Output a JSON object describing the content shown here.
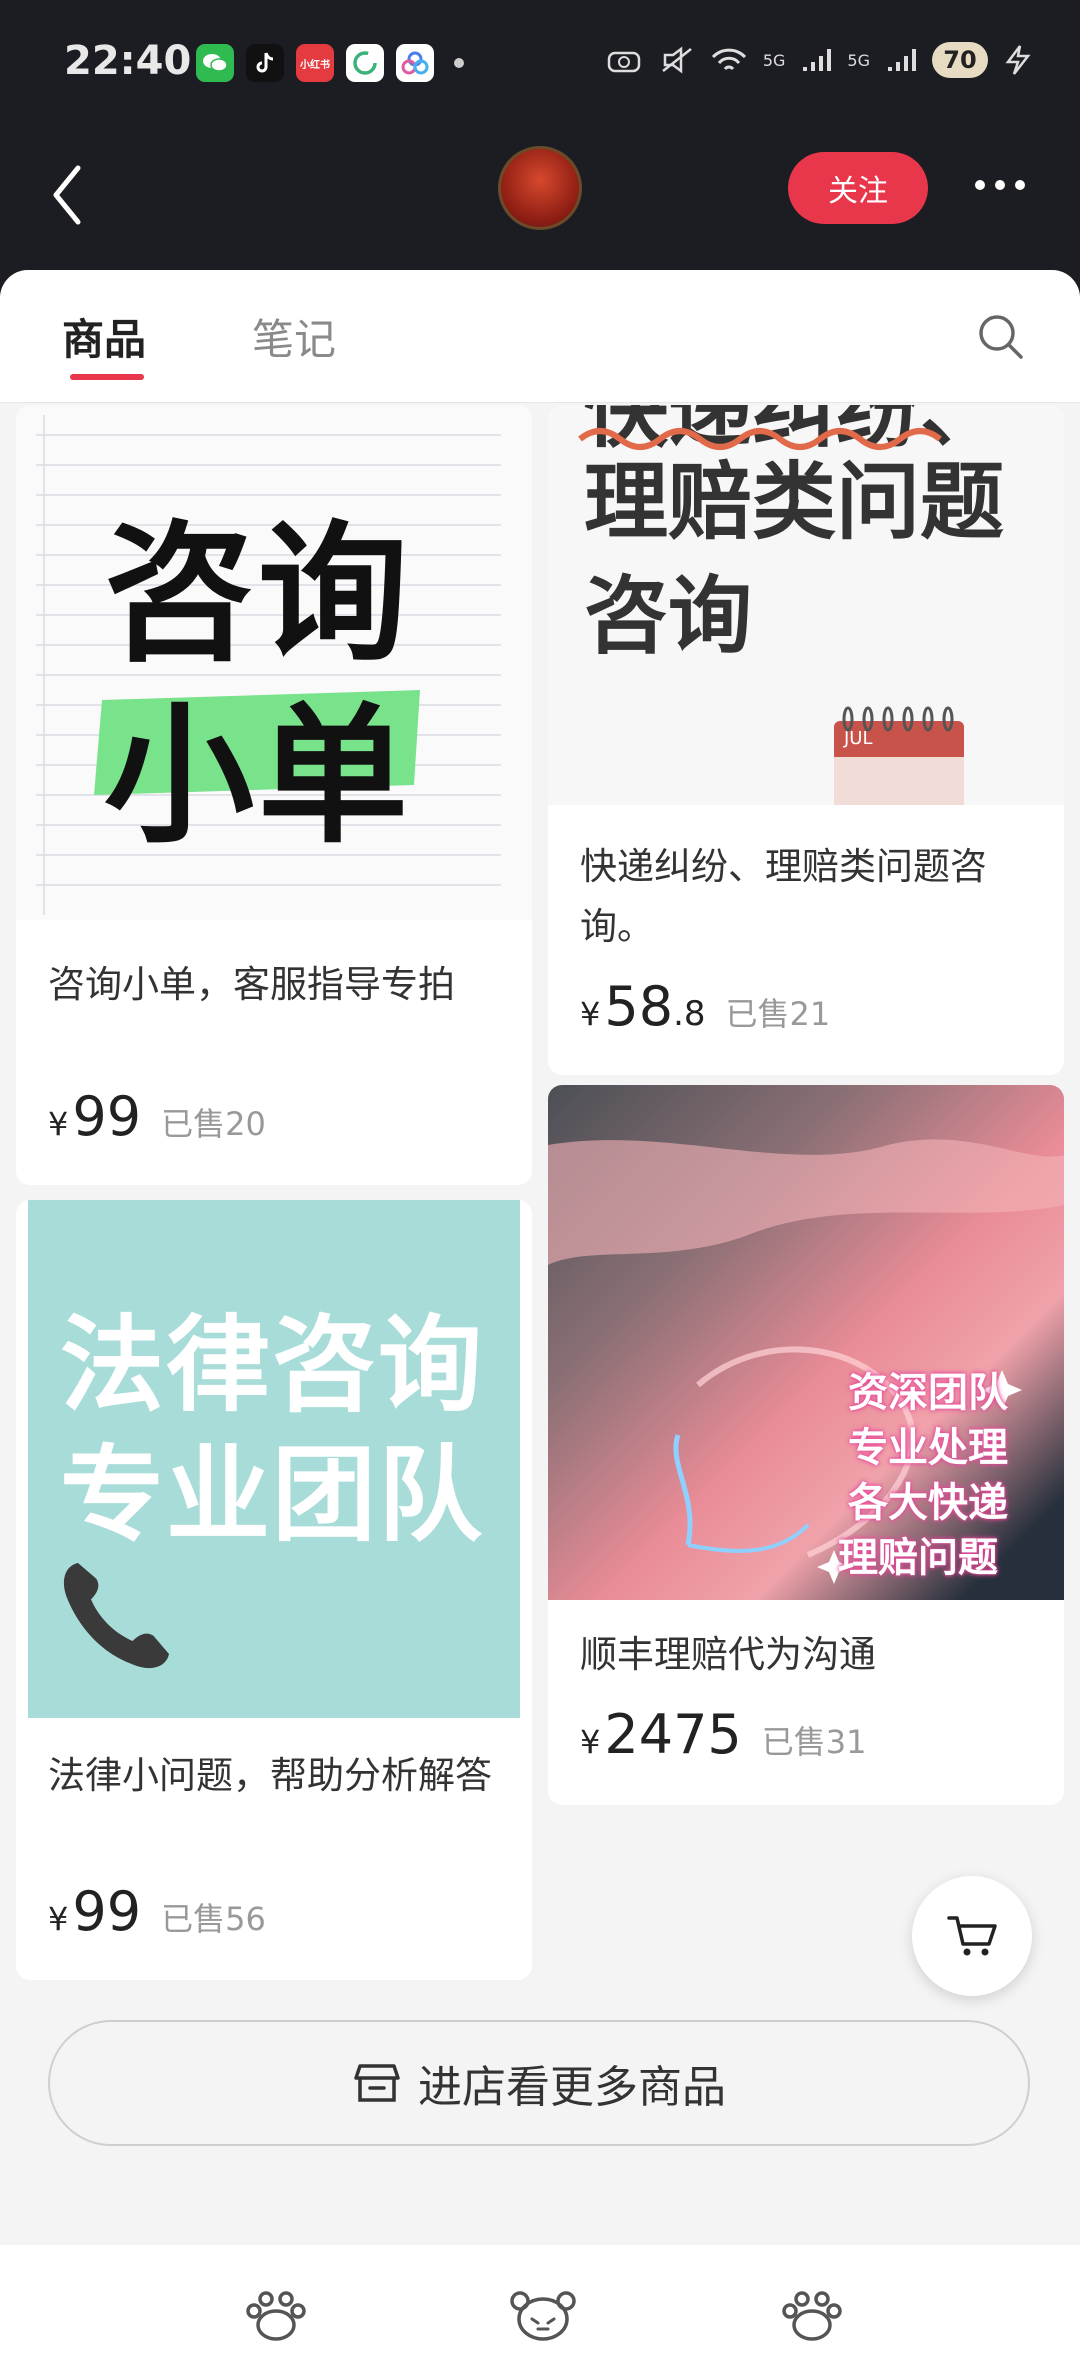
{
  "status_bar": {
    "time": "22:40",
    "apps": [
      {
        "icon": "wechat-icon",
        "color": "#2fbb4f",
        "label": ""
      },
      {
        "icon": "tiktok-icon",
        "color": "#111111",
        "label": ""
      },
      {
        "icon": "xiaohongshu-icon",
        "color": "#e33b3f",
        "label": "小红书"
      },
      {
        "icon": "circle-app-icon",
        "color": "#ffffff",
        "label": ""
      },
      {
        "icon": "cloud-app-icon",
        "color": "#ffffff",
        "label": ""
      }
    ],
    "network_labels": [
      "5G",
      "5G"
    ],
    "battery": "70"
  },
  "header": {
    "follow_label": "关注"
  },
  "tabs": [
    {
      "label": "商品",
      "active": true
    },
    {
      "label": "笔记",
      "active": false
    }
  ],
  "products": [
    {
      "image_lines": [
        "咨询",
        "小单"
      ],
      "title": "咨询小单，客服指导专拍",
      "price_int": "99",
      "price_dec": "",
      "sold": "已售20"
    },
    {
      "image_lines": [
        "快递纠纷、",
        "理赔类问题",
        "咨询"
      ],
      "image_calendar": "JUL",
      "title": "快递纠纷、理赔类问题咨询。",
      "price_int": "58",
      "price_dec": ".8",
      "sold": "已售21"
    },
    {
      "image_lines": [
        "法律咨询",
        "专业团队"
      ],
      "title": "法律小问题，帮助分析解答",
      "price_int": "99",
      "price_dec": "",
      "sold": "已售56"
    },
    {
      "image_lines": [
        "资深团队",
        "专业处理",
        "各大快递",
        "理赔问题"
      ],
      "title": "顺丰理赔代为沟通",
      "price_int": "2475",
      "price_dec": "",
      "sold": "已售31"
    }
  ],
  "currency": "¥",
  "more_products_label": "进店看更多商品",
  "colors": {
    "accent": "#e8374a",
    "highlight": "#79e38c",
    "teal": "#a8dcd8"
  }
}
